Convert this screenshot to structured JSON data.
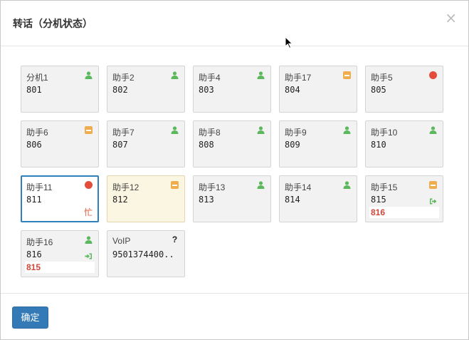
{
  "dialog": {
    "title": "转话（分机状态）",
    "close_symbol": "×",
    "ok_label": "确定"
  },
  "colors": {
    "online": "#5cb85c",
    "dnd": "#f0ad4e",
    "busy": "#e34d3a",
    "accent": "#337ab7"
  },
  "extensions": [
    {
      "name": "分机1",
      "number": "801",
      "status": "online"
    },
    {
      "name": "助手2",
      "number": "802",
      "status": "online"
    },
    {
      "name": "助手4",
      "number": "803",
      "status": "online"
    },
    {
      "name": "助手17",
      "number": "804",
      "status": "dnd"
    },
    {
      "name": "助手5",
      "number": "805",
      "status": "busy"
    },
    {
      "name": "助手6",
      "number": "806",
      "status": "dnd"
    },
    {
      "name": "助手7",
      "number": "807",
      "status": "online"
    },
    {
      "name": "助手8",
      "number": "808",
      "status": "online"
    },
    {
      "name": "助手9",
      "number": "809",
      "status": "online"
    },
    {
      "name": "助手10",
      "number": "810",
      "status": "online"
    },
    {
      "name": "助手11",
      "number": "811",
      "status": "busy",
      "flag": "忙"
    },
    {
      "name": "助手12",
      "number": "812",
      "status": "dnd"
    },
    {
      "name": "助手13",
      "number": "813",
      "status": "online"
    },
    {
      "name": "助手14",
      "number": "814",
      "status": "online"
    },
    {
      "name": "助手15",
      "number": "815",
      "status": "dnd",
      "transfer": "out",
      "peer": "816"
    },
    {
      "name": "助手16",
      "number": "816",
      "status": "online",
      "transfer": "in",
      "peer": "815"
    },
    {
      "name": "VoIP",
      "number": "9501374400..",
      "status": "unknown",
      "status_text": "?"
    }
  ]
}
